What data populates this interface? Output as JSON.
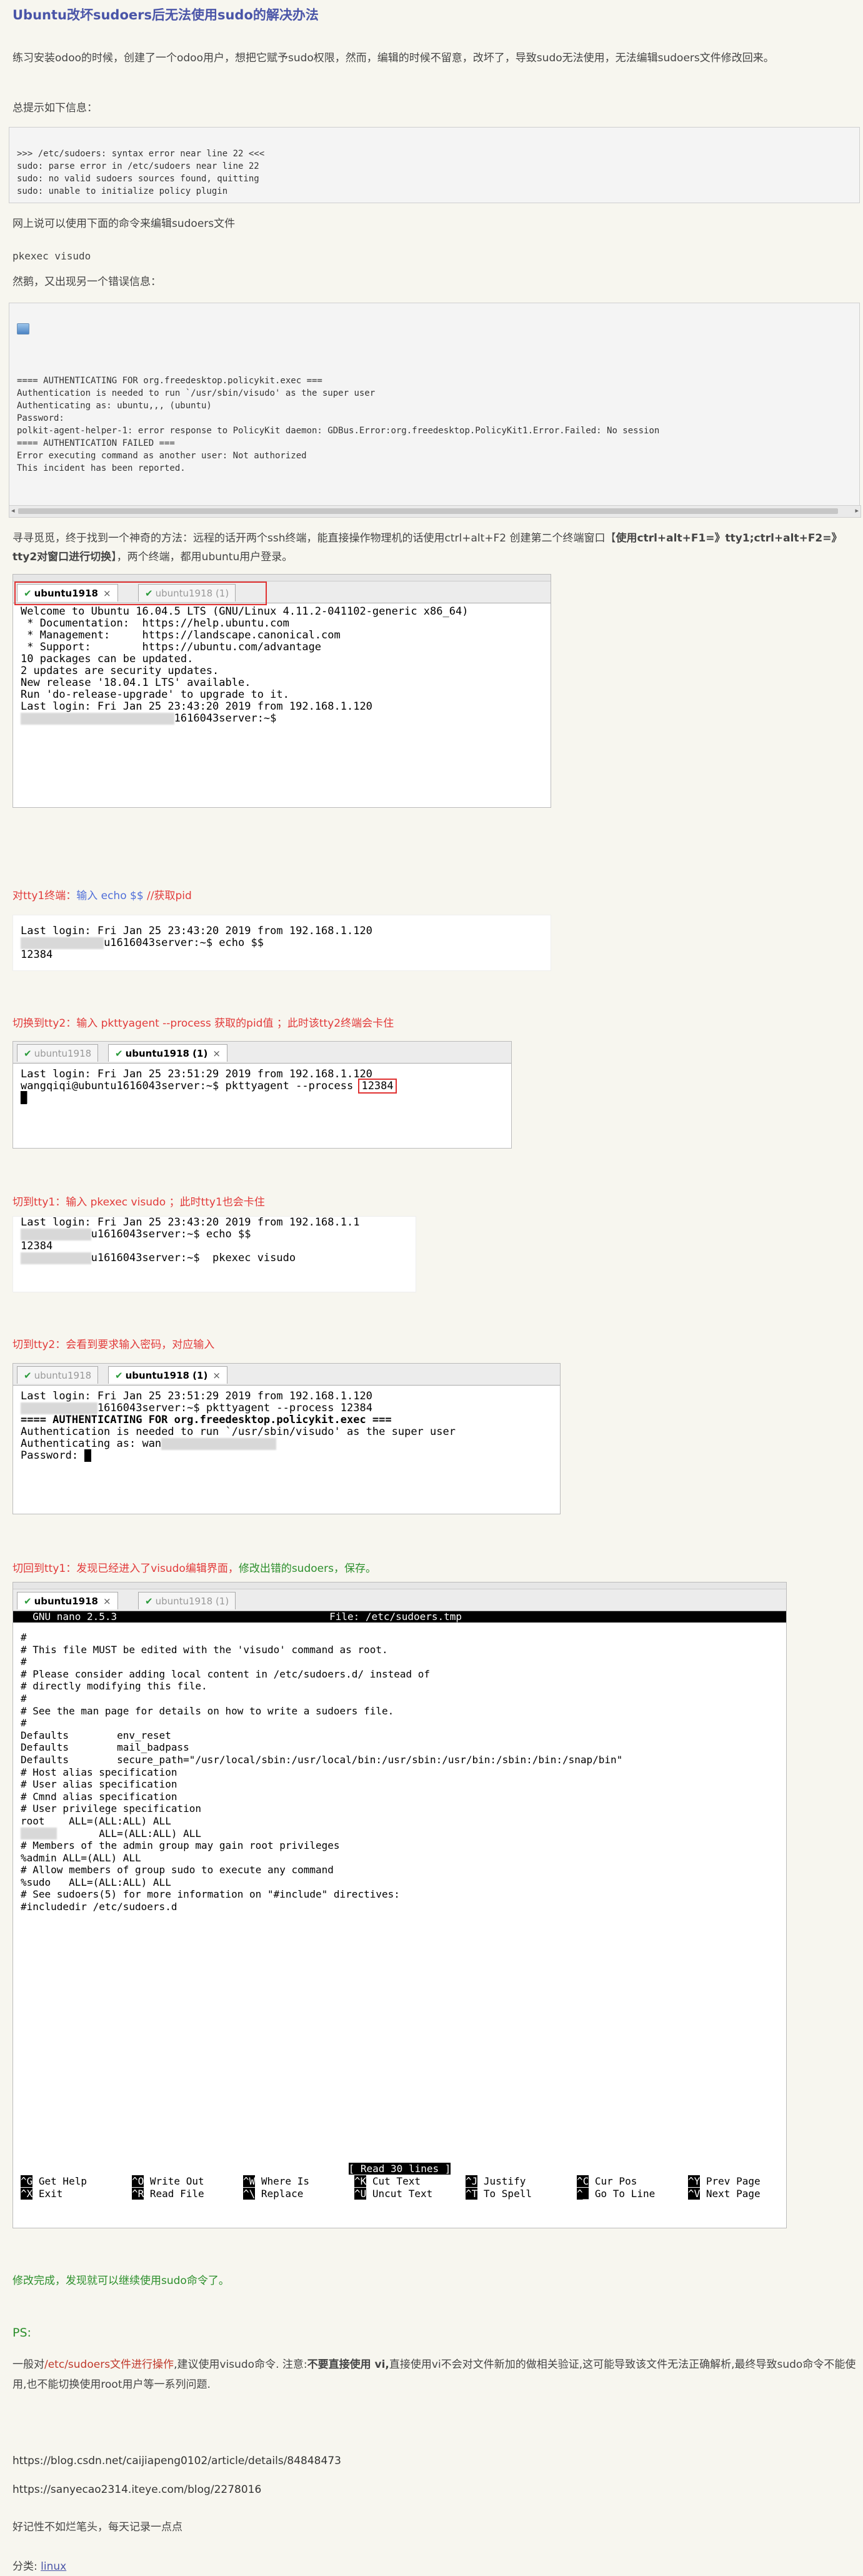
{
  "article": {
    "title": "Ubuntu改坏sudoers后无法使用sudo的解决办法",
    "intro": "练习安装odoo的时候，创建了一个odoo用户，想把它赋予sudo权限，然而，编辑的时候不留意，改坏了，导致sudo无法使用，无法编辑sudoers文件修改回来。",
    "summary_label": "总提示如下信息：",
    "error_block_1": [
      ">>> /etc/sudoers: syntax error near line 22 <<<",
      "sudo: parse error in /etc/sudoers near line 22",
      "sudo: no valid sudoers sources found, quitting",
      "sudo: unable to initialize policy plugin"
    ],
    "online_tip": "网上说可以使用下面的命令来编辑sudoers文件",
    "pkexec_cmd": "pkexec visudo",
    "then_error": "然鹅，又出现另一个错误信息：",
    "error_block_2": [
      "==== AUTHENTICATING FOR org.freedesktop.policykit.exec ===",
      "Authentication is needed to run `/usr/sbin/visudo' as the super user",
      "Authenticating as: ubuntu,,, (ubuntu)",
      "Password:",
      "polkit-agent-helper-1: error response to PolicyKit daemon: GDBus.Error:org.freedesktop.PolicyKit1.Error.Failed: No session",
      "==== AUTHENTICATION FAILED ===",
      "Error executing command as another user: Not authorized",
      "This incident has been reported."
    ],
    "method_text_a": "寻寻觅觅，终于找到一个神奇的方法：远程的话开两个ssh终端，能直接操作物理机的话使用ctrl+alt+F2 创建第二个终端窗口【",
    "method_text_bold": "使用ctrl+alt+F1=》tty1;ctrl+alt+F2=》tty2对窗口进行切换",
    "method_text_b": "】，两个终端，都用ubuntu用户登录。",
    "step1_a": "对tty1终端：",
    "step1_b": "输入 echo $$",
    "step1_c": " //获取pid",
    "step2_a": "切换到tty2：",
    "step2_b": "输入 pkttyagent --process 获取的pid值",
    "step2_c": " ；此时该tty2终端会卡住",
    "step3_a": "切到tty1：",
    "step3_b": "输入 pkexec visudo",
    "step3_c": "     ；此时tty1也会卡住",
    "step4": "切到tty2：会看到要求输入密码，对应输入",
    "step5_a": "切回到tty1：发现已经进入了visudo编辑界面，",
    "step5_b": "修改出错的sudoers，保存。",
    "done": "修改完成，发现就可以继续使用sudo命令了。",
    "ps_label": "PS:",
    "ps_a": "一般对",
    "ps_path": "/etc/sudoers文件进行操作",
    "ps_b": ",建议使用visudo命令. 注意:",
    "ps_bold": "不要直接使用 vi,",
    "ps_c": "直接使用vi不会对文件新加的做相关验证,这可能导致该文件无法正确解析,最终导致sudo命令不能使用,也不能切换使用root用户等一系列问题.",
    "ref1": "https://blog.csdn.net/caijiapeng0102/article/details/84848473",
    "ref2": "https://sanyecao2314.iteye.com/blog/2278016",
    "motto": "好记性不如烂笔头，每天记录一点点",
    "category_label": "分类:",
    "category_value": "linux"
  },
  "terminals": {
    "tab_active_1": "ubuntu1918",
    "tab_inactive_1": "ubuntu1918 (1)",
    "tab_active_2": "ubuntu1918 (1)",
    "tab_inactive_2": "ubuntu1918",
    "close": "×",
    "t1_lines": [
      "Welcome to Ubuntu 16.04.5 LTS (GNU/Linux 4.11.2-041102-generic x86_64)",
      "",
      " * Documentation:  https://help.ubuntu.com",
      " * Management:     https://landscape.canonical.com",
      " * Support:        https://ubuntu.com/advantage",
      "",
      "10 packages can be updated.",
      "2 updates are security updates.",
      "",
      "New release '18.04.1 LTS' available.",
      "Run 'do-release-upgrade' to upgrade to it.",
      "",
      "",
      "Last login: Fri Jan 25 23:43:20 2019 from 192.168.1.120"
    ],
    "t1_prompt_suffix": "1616043server:~$",
    "t2_line1": "Last login: Fri Jan 25 23:43:20 2019 from 192.168.1.120",
    "t2_line2_suffix": "u1616043server:~$ echo $$",
    "t2_line3": "12384",
    "t3_line1": "Last login: Fri Jan 25 23:51:29 2019 from 192.168.1.120",
    "t3_line2": "wangqiqi@ubuntu1616043server:~$ pkttyagent --process ",
    "t3_pid": "12384",
    "t4_line1": "Last login: Fri Jan 25 23:43:20 2019 from 192.168.1.1",
    "t4_line2_suffix": "u1616043server:~$ echo $$",
    "t4_line3": "12384",
    "t4_line4_suffix": "u1616043server:~$  pkexec visudo",
    "t5_line1": "Last login: Fri Jan 25 23:51:29 2019 from 192.168.1.120",
    "t5_line2_suffix": "1616043server:~$ pkttyagent --process 12384",
    "t5_line3": "==== AUTHENTICATING FOR org.freedesktop.policykit.exec ===",
    "t5_line4": "Authentication is needed to run `/usr/sbin/visudo' as the super user",
    "t5_line5": "Authenticating as: wan",
    "t5_line6": "Password: "
  },
  "nano": {
    "header_left": "  GNU nano 2.5.3",
    "header_file": "File: /etc/sudoers.tmp",
    "lines": [
      "#",
      "# This file MUST be edited with the 'visudo' command as root.",
      "#",
      "# Please consider adding local content in /etc/sudoers.d/ instead of",
      "# directly modifying this file.",
      "#",
      "# See the man page for details on how to write a sudoers file.",
      "#",
      "Defaults        env_reset",
      "Defaults        mail_badpass",
      "Defaults        secure_path=\"/usr/local/sbin:/usr/local/bin:/usr/sbin:/usr/bin:/sbin:/bin:/snap/bin\"",
      "",
      "# Host alias specification",
      "",
      "# User alias specification",
      "",
      "# Cmnd alias specification",
      "",
      "# User privilege specification",
      "root    ALL=(ALL:ALL) ALL",
      "       ALL=(ALL:ALL) ALL",
      "# Members of the admin group may gain root privileges",
      "%admin ALL=(ALL) ALL",
      "",
      "# Allow members of group sudo to execute any command",
      "%sudo   ALL=(ALL:ALL) ALL",
      "",
      "# See sudoers(5) for more information on \"#include\" directives:",
      "",
      "#includedir /etc/sudoers.d"
    ],
    "status": "[ Read 30 lines ]",
    "shortcuts_row1": [
      {
        "k": "^G",
        "t": "Get Help"
      },
      {
        "k": "^O",
        "t": "Write Out"
      },
      {
        "k": "^W",
        "t": "Where Is"
      },
      {
        "k": "^K",
        "t": "Cut Text"
      },
      {
        "k": "^J",
        "t": "Justify"
      },
      {
        "k": "^C",
        "t": "Cur Pos"
      },
      {
        "k": "^Y",
        "t": "Prev Page"
      }
    ],
    "shortcuts_row2": [
      {
        "k": "^X",
        "t": "Exit"
      },
      {
        "k": "^R",
        "t": "Read File"
      },
      {
        "k": "^\\",
        "t": "Replace"
      },
      {
        "k": "^U",
        "t": "Uncut Text"
      },
      {
        "k": "^T",
        "t": "To Spell"
      },
      {
        "k": "^_",
        "t": "Go To Line"
      },
      {
        "k": "^V",
        "t": "Next Page"
      }
    ]
  }
}
